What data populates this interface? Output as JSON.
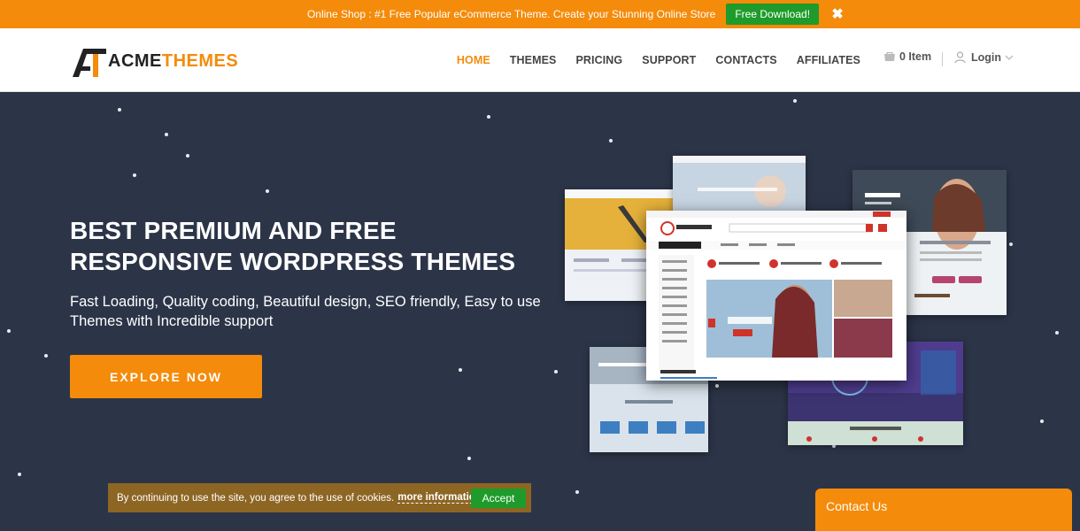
{
  "promo": {
    "text": "Online Shop : #1 Free Popular eCommerce Theme. Create your Stunning Online Store",
    "button_label": "Free Download!",
    "close_icon": "close-icon"
  },
  "header": {
    "logo": {
      "acme": "ACME",
      "themes": "THEMES"
    },
    "nav": [
      {
        "label": "HOME",
        "active": true
      },
      {
        "label": "THEMES",
        "active": false
      },
      {
        "label": "PRICING",
        "active": false
      },
      {
        "label": "SUPPORT",
        "active": false
      },
      {
        "label": "CONTACTS",
        "active": false
      },
      {
        "label": "AFFILIATES",
        "active": false
      }
    ],
    "cart_label": "0 Item",
    "login_label": "Login"
  },
  "hero": {
    "title": "BEST PREMIUM AND FREE RESPONSIVE WORDPRESS THEMES",
    "subtitle": "Fast Loading, Quality coding, Beautiful design, SEO friendly, Easy to use Themes with Incredible support",
    "cta_label": "EXPLORE NOW"
  },
  "cookie": {
    "text": "By continuing to use the site, you agree to the use of cookies.",
    "link_label": "more information",
    "accept_label": "Accept"
  },
  "contact_label": "Contact Us",
  "colors": {
    "accent": "#f48b0b",
    "hero_bg": "#2c3548",
    "green": "#1e9b2a"
  }
}
